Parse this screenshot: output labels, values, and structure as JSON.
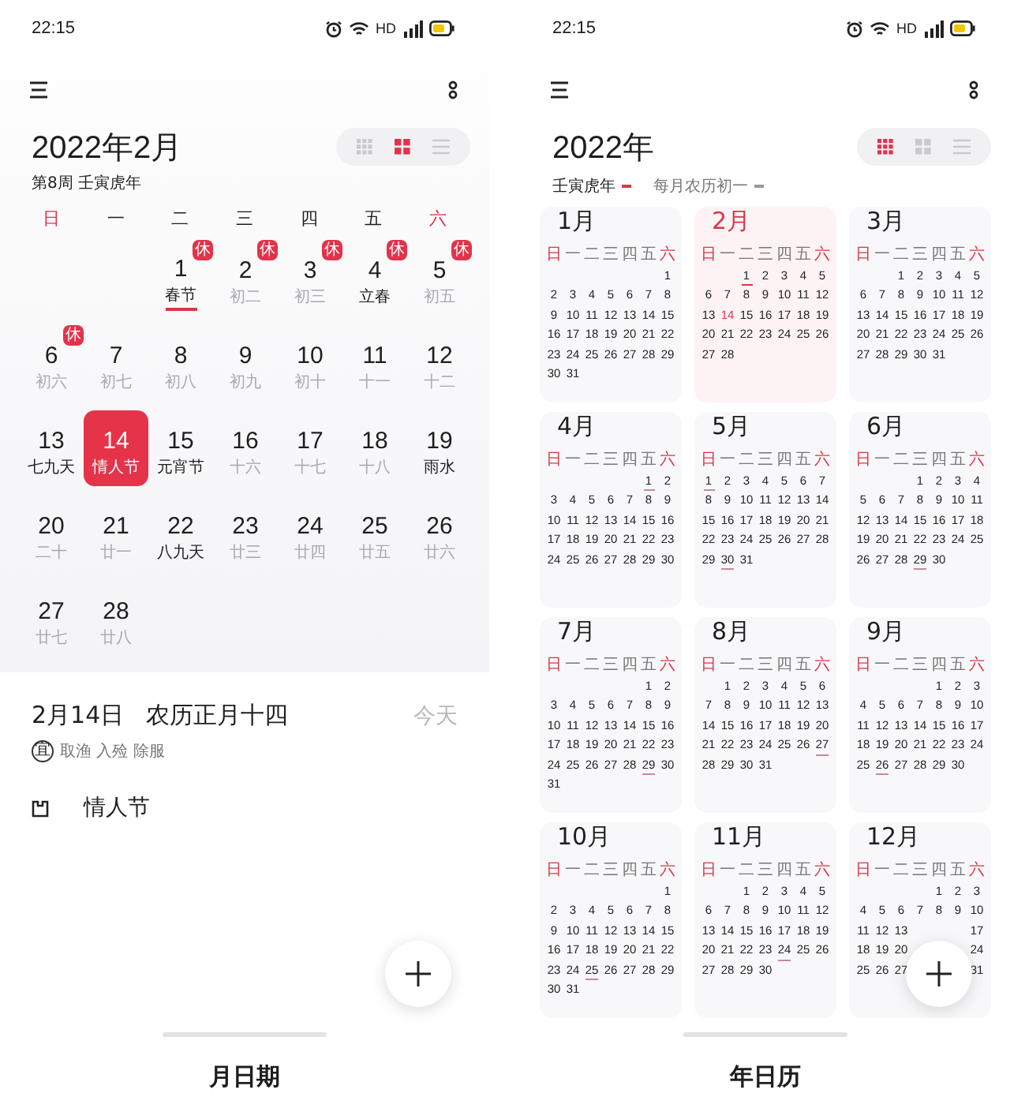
{
  "month_view": {
    "status_bar": {
      "time": "22:15",
      "network": "HD"
    },
    "title": "2022年2月",
    "subtitle": "第8周 壬寅虎年",
    "view_modes": [
      {
        "kind": "year",
        "selected": false
      },
      {
        "kind": "month",
        "selected": true
      },
      {
        "kind": "list",
        "selected": false
      }
    ],
    "weekdays": [
      {
        "label": "日",
        "weekend": true
      },
      {
        "label": "一",
        "weekend": false
      },
      {
        "label": "二",
        "weekend": false
      },
      {
        "label": "三",
        "weekend": false
      },
      {
        "label": "四",
        "weekend": false
      },
      {
        "label": "五",
        "weekend": false
      },
      {
        "label": "六",
        "weekend": true
      }
    ],
    "days": [
      {
        "day": "1",
        "label": "春节",
        "kind": "festival",
        "badge": "休",
        "selected": false,
        "underlined": true
      },
      {
        "day": "2",
        "label": "初二",
        "kind": "lunar",
        "badge": "休",
        "selected": false,
        "underlined": false
      },
      {
        "day": "3",
        "label": "初三",
        "kind": "lunar",
        "badge": "休",
        "selected": false,
        "underlined": false
      },
      {
        "day": "4",
        "label": "立春",
        "kind": "festival",
        "badge": "休",
        "selected": false,
        "underlined": false
      },
      {
        "day": "5",
        "label": "初五",
        "kind": "lunar",
        "badge": "休",
        "selected": false,
        "underlined": false
      },
      {
        "day": "6",
        "label": "初六",
        "kind": "lunar",
        "badge": "休",
        "selected": false,
        "underlined": false
      },
      {
        "day": "7",
        "label": "初七",
        "kind": "lunar",
        "selected": false,
        "underlined": false
      },
      {
        "day": "8",
        "label": "初八",
        "kind": "lunar",
        "selected": false,
        "underlined": false
      },
      {
        "day": "9",
        "label": "初九",
        "kind": "lunar",
        "selected": false,
        "underlined": false
      },
      {
        "day": "10",
        "label": "初十",
        "kind": "lunar",
        "selected": false,
        "underlined": false
      },
      {
        "day": "11",
        "label": "十一",
        "kind": "lunar",
        "selected": false,
        "underlined": false
      },
      {
        "day": "12",
        "label": "十二",
        "kind": "lunar",
        "selected": false,
        "underlined": false
      },
      {
        "day": "13",
        "label": "七九天",
        "kind": "festival",
        "selected": false,
        "underlined": false
      },
      {
        "day": "14",
        "label": "情人节",
        "kind": "festival",
        "selected": true,
        "underlined": false
      },
      {
        "day": "15",
        "label": "元宵节",
        "kind": "festival",
        "selected": false,
        "underlined": false
      },
      {
        "day": "16",
        "label": "十六",
        "kind": "lunar",
        "selected": false,
        "underlined": false
      },
      {
        "day": "17",
        "label": "十七",
        "kind": "lunar",
        "selected": false,
        "underlined": false
      },
      {
        "day": "18",
        "label": "十八",
        "kind": "lunar",
        "selected": false,
        "underlined": false
      },
      {
        "day": "19",
        "label": "雨水",
        "kind": "festival",
        "selected": false,
        "underlined": false
      },
      {
        "day": "20",
        "label": "二十",
        "kind": "lunar",
        "selected": false,
        "underlined": false
      },
      {
        "day": "21",
        "label": "廿一",
        "kind": "lunar",
        "selected": false,
        "underlined": false
      },
      {
        "day": "22",
        "label": "八九天",
        "kind": "festival",
        "selected": false,
        "underlined": false
      },
      {
        "day": "23",
        "label": "廿三",
        "kind": "lunar",
        "selected": false,
        "underlined": false
      },
      {
        "day": "24",
        "label": "廿四",
        "kind": "lunar",
        "selected": false,
        "underlined": false
      },
      {
        "day": "25",
        "label": "廿五",
        "kind": "lunar",
        "selected": false,
        "underlined": false
      },
      {
        "day": "26",
        "label": "廿六",
        "kind": "lunar",
        "selected": false,
        "underlined": false
      },
      {
        "day": "27",
        "label": "廿七",
        "kind": "lunar",
        "selected": false,
        "underlined": false
      },
      {
        "day": "28",
        "label": "廿八",
        "kind": "lunar",
        "selected": false,
        "underlined": false
      }
    ],
    "detail": {
      "date": "2月14日",
      "lunar": "农历正月十四",
      "today": "今天",
      "almanac_badge": "宜",
      "almanac": "取渔 入殓 除服",
      "events": [
        {
          "title": "情人节"
        }
      ]
    },
    "tab": "月日期"
  },
  "year_view": {
    "status_bar": {
      "time": "22:15",
      "network": "HD"
    },
    "title": "2022年",
    "legend": [
      {
        "label": "壬寅虎年",
        "kind": "holiday"
      },
      {
        "label": "每月农历初一",
        "kind": "lunar"
      }
    ],
    "view_modes": [
      {
        "kind": "year",
        "selected": true
      },
      {
        "kind": "month",
        "selected": false
      },
      {
        "kind": "list",
        "selected": false
      }
    ],
    "months": [
      {
        "title": "1月",
        "current": false,
        "weekdays": [
          "日",
          "一",
          "二",
          "三",
          "四",
          "五",
          "六"
        ],
        "days": [
          {
            "d": "1"
          },
          {
            "d": "2"
          },
          {
            "d": "3"
          },
          {
            "d": "4"
          },
          {
            "d": "5"
          },
          {
            "d": "6"
          },
          {
            "d": "7"
          },
          {
            "d": "8"
          },
          {
            "d": "9"
          },
          {
            "d": "10"
          },
          {
            "d": "11"
          },
          {
            "d": "12"
          },
          {
            "d": "13"
          },
          {
            "d": "14"
          },
          {
            "d": "15"
          },
          {
            "d": "16"
          },
          {
            "d": "17"
          },
          {
            "d": "18"
          },
          {
            "d": "19"
          },
          {
            "d": "20"
          },
          {
            "d": "21"
          },
          {
            "d": "22"
          },
          {
            "d": "23"
          },
          {
            "d": "24"
          },
          {
            "d": "25"
          },
          {
            "d": "26"
          },
          {
            "d": "27"
          },
          {
            "d": "28"
          },
          {
            "d": "29"
          },
          {
            "d": "30"
          },
          {
            "d": "31"
          }
        ]
      },
      {
        "title": "2月",
        "current": true,
        "weekdays": [
          "日",
          "一",
          "二",
          "三",
          "四",
          "五",
          "六"
        ],
        "days": [
          {
            "d": "1",
            "kind": "holiday"
          },
          {
            "d": "2"
          },
          {
            "d": "3"
          },
          {
            "d": "4"
          },
          {
            "d": "5"
          },
          {
            "d": "6"
          },
          {
            "d": "7"
          },
          {
            "d": "8"
          },
          {
            "d": "9"
          },
          {
            "d": "10"
          },
          {
            "d": "11"
          },
          {
            "d": "12"
          },
          {
            "d": "13"
          },
          {
            "d": "14",
            "kind": "today"
          },
          {
            "d": "15"
          },
          {
            "d": "16"
          },
          {
            "d": "17"
          },
          {
            "d": "18"
          },
          {
            "d": "19"
          },
          {
            "d": "20"
          },
          {
            "d": "21"
          },
          {
            "d": "22"
          },
          {
            "d": "23"
          },
          {
            "d": "24"
          },
          {
            "d": "25"
          },
          {
            "d": "26"
          },
          {
            "d": "27"
          },
          {
            "d": "28"
          }
        ]
      },
      {
        "title": "3月",
        "current": false,
        "weekdays": [
          "日",
          "一",
          "二",
          "三",
          "四",
          "五",
          "六"
        ],
        "days": [
          {
            "d": "1"
          },
          {
            "d": "2"
          },
          {
            "d": "3"
          },
          {
            "d": "4"
          },
          {
            "d": "5"
          },
          {
            "d": "6"
          },
          {
            "d": "7"
          },
          {
            "d": "8"
          },
          {
            "d": "9"
          },
          {
            "d": "10"
          },
          {
            "d": "11"
          },
          {
            "d": "12"
          },
          {
            "d": "13"
          },
          {
            "d": "14"
          },
          {
            "d": "15"
          },
          {
            "d": "16"
          },
          {
            "d": "17"
          },
          {
            "d": "18"
          },
          {
            "d": "19"
          },
          {
            "d": "20"
          },
          {
            "d": "21"
          },
          {
            "d": "22"
          },
          {
            "d": "23"
          },
          {
            "d": "24"
          },
          {
            "d": "25"
          },
          {
            "d": "26"
          },
          {
            "d": "27"
          },
          {
            "d": "28"
          },
          {
            "d": "29"
          },
          {
            "d": "30"
          },
          {
            "d": "31"
          }
        ]
      },
      {
        "title": "4月",
        "current": false,
        "weekdays": [
          "日",
          "一",
          "二",
          "三",
          "四",
          "五",
          "六"
        ],
        "days": [
          {
            "d": "1",
            "kind": "lunar"
          },
          {
            "d": "2"
          },
          {
            "d": "3"
          },
          {
            "d": "4"
          },
          {
            "d": "5"
          },
          {
            "d": "6"
          },
          {
            "d": "7"
          },
          {
            "d": "8"
          },
          {
            "d": "9"
          },
          {
            "d": "10"
          },
          {
            "d": "11"
          },
          {
            "d": "12"
          },
          {
            "d": "13"
          },
          {
            "d": "14"
          },
          {
            "d": "15"
          },
          {
            "d": "16"
          },
          {
            "d": "17"
          },
          {
            "d": "18"
          },
          {
            "d": "19"
          },
          {
            "d": "20"
          },
          {
            "d": "21"
          },
          {
            "d": "22"
          },
          {
            "d": "23"
          },
          {
            "d": "24"
          },
          {
            "d": "25"
          },
          {
            "d": "26"
          },
          {
            "d": "27"
          },
          {
            "d": "28"
          },
          {
            "d": "29"
          },
          {
            "d": "30"
          }
        ]
      },
      {
        "title": "5月",
        "current": false,
        "weekdays": [
          "日",
          "一",
          "二",
          "三",
          "四",
          "五",
          "六"
        ],
        "days": [
          {
            "d": "1",
            "kind": "lunar"
          },
          {
            "d": "2"
          },
          {
            "d": "3"
          },
          {
            "d": "4"
          },
          {
            "d": "5"
          },
          {
            "d": "6"
          },
          {
            "d": "7"
          },
          {
            "d": "8"
          },
          {
            "d": "9"
          },
          {
            "d": "10"
          },
          {
            "d": "11"
          },
          {
            "d": "12"
          },
          {
            "d": "13"
          },
          {
            "d": "14"
          },
          {
            "d": "15"
          },
          {
            "d": "16"
          },
          {
            "d": "17"
          },
          {
            "d": "18"
          },
          {
            "d": "19"
          },
          {
            "d": "20"
          },
          {
            "d": "21"
          },
          {
            "d": "22"
          },
          {
            "d": "23"
          },
          {
            "d": "24"
          },
          {
            "d": "25"
          },
          {
            "d": "26"
          },
          {
            "d": "27"
          },
          {
            "d": "28"
          },
          {
            "d": "29"
          },
          {
            "d": "30",
            "kind": "lunar"
          },
          {
            "d": "31"
          }
        ]
      },
      {
        "title": "6月",
        "current": false,
        "weekdays": [
          "日",
          "一",
          "二",
          "三",
          "四",
          "五",
          "六"
        ],
        "days": [
          {
            "d": "1"
          },
          {
            "d": "2"
          },
          {
            "d": "3"
          },
          {
            "d": "4"
          },
          {
            "d": "5"
          },
          {
            "d": "6"
          },
          {
            "d": "7"
          },
          {
            "d": "8"
          },
          {
            "d": "9"
          },
          {
            "d": "10"
          },
          {
            "d": "11"
          },
          {
            "d": "12"
          },
          {
            "d": "13"
          },
          {
            "d": "14"
          },
          {
            "d": "15"
          },
          {
            "d": "16"
          },
          {
            "d": "17"
          },
          {
            "d": "18"
          },
          {
            "d": "19"
          },
          {
            "d": "20"
          },
          {
            "d": "21"
          },
          {
            "d": "22"
          },
          {
            "d": "23"
          },
          {
            "d": "24"
          },
          {
            "d": "25"
          },
          {
            "d": "26"
          },
          {
            "d": "27"
          },
          {
            "d": "28"
          },
          {
            "d": "29",
            "kind": "lunar"
          },
          {
            "d": "30"
          }
        ]
      },
      {
        "title": "7月",
        "current": false,
        "weekdays": [
          "日",
          "一",
          "二",
          "三",
          "四",
          "五",
          "六"
        ],
        "days": [
          {
            "d": "1"
          },
          {
            "d": "2"
          },
          {
            "d": "3"
          },
          {
            "d": "4"
          },
          {
            "d": "5"
          },
          {
            "d": "6"
          },
          {
            "d": "7"
          },
          {
            "d": "8"
          },
          {
            "d": "9"
          },
          {
            "d": "10"
          },
          {
            "d": "11"
          },
          {
            "d": "12"
          },
          {
            "d": "13"
          },
          {
            "d": "14"
          },
          {
            "d": "15"
          },
          {
            "d": "16"
          },
          {
            "d": "17"
          },
          {
            "d": "18"
          },
          {
            "d": "19"
          },
          {
            "d": "20"
          },
          {
            "d": "21"
          },
          {
            "d": "22"
          },
          {
            "d": "23"
          },
          {
            "d": "24"
          },
          {
            "d": "25"
          },
          {
            "d": "26"
          },
          {
            "d": "27"
          },
          {
            "d": "28"
          },
          {
            "d": "29",
            "kind": "lunar"
          },
          {
            "d": "30"
          },
          {
            "d": "31"
          }
        ]
      },
      {
        "title": "8月",
        "current": false,
        "weekdays": [
          "日",
          "一",
          "二",
          "三",
          "四",
          "五",
          "六"
        ],
        "days": [
          {
            "d": "1"
          },
          {
            "d": "2"
          },
          {
            "d": "3"
          },
          {
            "d": "4"
          },
          {
            "d": "5"
          },
          {
            "d": "6"
          },
          {
            "d": "7"
          },
          {
            "d": "8"
          },
          {
            "d": "9"
          },
          {
            "d": "10"
          },
          {
            "d": "11"
          },
          {
            "d": "12"
          },
          {
            "d": "13"
          },
          {
            "d": "14"
          },
          {
            "d": "15"
          },
          {
            "d": "16"
          },
          {
            "d": "17"
          },
          {
            "d": "18"
          },
          {
            "d": "19"
          },
          {
            "d": "20"
          },
          {
            "d": "21"
          },
          {
            "d": "22"
          },
          {
            "d": "23"
          },
          {
            "d": "24"
          },
          {
            "d": "25"
          },
          {
            "d": "26"
          },
          {
            "d": "27",
            "kind": "lunar"
          },
          {
            "d": "28"
          },
          {
            "d": "29"
          },
          {
            "d": "30"
          },
          {
            "d": "31"
          }
        ]
      },
      {
        "title": "9月",
        "current": false,
        "weekdays": [
          "日",
          "一",
          "二",
          "三",
          "四",
          "五",
          "六"
        ],
        "days": [
          {
            "d": "1"
          },
          {
            "d": "2"
          },
          {
            "d": "3"
          },
          {
            "d": "4"
          },
          {
            "d": "5"
          },
          {
            "d": "6"
          },
          {
            "d": "7"
          },
          {
            "d": "8"
          },
          {
            "d": "9"
          },
          {
            "d": "10"
          },
          {
            "d": "11"
          },
          {
            "d": "12"
          },
          {
            "d": "13"
          },
          {
            "d": "14"
          },
          {
            "d": "15"
          },
          {
            "d": "16"
          },
          {
            "d": "17"
          },
          {
            "d": "18"
          },
          {
            "d": "19"
          },
          {
            "d": "20"
          },
          {
            "d": "21"
          },
          {
            "d": "22"
          },
          {
            "d": "23"
          },
          {
            "d": "24"
          },
          {
            "d": "25"
          },
          {
            "d": "26",
            "kind": "lunar"
          },
          {
            "d": "27"
          },
          {
            "d": "28"
          },
          {
            "d": "29"
          },
          {
            "d": "30"
          }
        ]
      },
      {
        "title": "10月",
        "current": false,
        "weekdays": [
          "日",
          "一",
          "二",
          "三",
          "四",
          "五",
          "六"
        ],
        "days": [
          {
            "d": "1"
          },
          {
            "d": "2"
          },
          {
            "d": "3"
          },
          {
            "d": "4"
          },
          {
            "d": "5"
          },
          {
            "d": "6"
          },
          {
            "d": "7"
          },
          {
            "d": "8"
          },
          {
            "d": "9"
          },
          {
            "d": "10"
          },
          {
            "d": "11"
          },
          {
            "d": "12"
          },
          {
            "d": "13"
          },
          {
            "d": "14"
          },
          {
            "d": "15"
          },
          {
            "d": "16"
          },
          {
            "d": "17"
          },
          {
            "d": "18"
          },
          {
            "d": "19"
          },
          {
            "d": "20"
          },
          {
            "d": "21"
          },
          {
            "d": "22"
          },
          {
            "d": "23"
          },
          {
            "d": "24"
          },
          {
            "d": "25",
            "kind": "lunar"
          },
          {
            "d": "26"
          },
          {
            "d": "27"
          },
          {
            "d": "28"
          },
          {
            "d": "29"
          },
          {
            "d": "30"
          },
          {
            "d": "31"
          }
        ]
      },
      {
        "title": "11月",
        "current": false,
        "weekdays": [
          "日",
          "一",
          "二",
          "三",
          "四",
          "五",
          "六"
        ],
        "days": [
          {
            "d": "1"
          },
          {
            "d": "2"
          },
          {
            "d": "3"
          },
          {
            "d": "4"
          },
          {
            "d": "5"
          },
          {
            "d": "6"
          },
          {
            "d": "7"
          },
          {
            "d": "8"
          },
          {
            "d": "9"
          },
          {
            "d": "10"
          },
          {
            "d": "11"
          },
          {
            "d": "12"
          },
          {
            "d": "13"
          },
          {
            "d": "14"
          },
          {
            "d": "15"
          },
          {
            "d": "16"
          },
          {
            "d": "17"
          },
          {
            "d": "18"
          },
          {
            "d": "19"
          },
          {
            "d": "20"
          },
          {
            "d": "21"
          },
          {
            "d": "22"
          },
          {
            "d": "23"
          },
          {
            "d": "24",
            "kind": "lunar"
          },
          {
            "d": "25"
          },
          {
            "d": "26"
          },
          {
            "d": "27"
          },
          {
            "d": "28"
          },
          {
            "d": "29"
          },
          {
            "d": "30"
          }
        ]
      },
      {
        "title": "12月",
        "current": false,
        "weekdays": [
          "日",
          "一",
          "二",
          "三",
          "四",
          "五",
          "六"
        ],
        "days": [
          {
            "d": "1"
          },
          {
            "d": "2"
          },
          {
            "d": "3"
          },
          {
            "d": "4"
          },
          {
            "d": "5"
          },
          {
            "d": "6"
          },
          {
            "d": "7"
          },
          {
            "d": "8"
          },
          {
            "d": "9"
          },
          {
            "d": "10"
          },
          {
            "d": "11"
          },
          {
            "d": "12"
          },
          {
            "d": "13"
          },
          {
            "kind": "covered"
          },
          {
            "kind": "covered"
          },
          {
            "kind": "covered"
          },
          {
            "d": "17"
          },
          {
            "d": "18"
          },
          {
            "d": "19"
          },
          {
            "d": "20"
          },
          {
            "kind": "covered"
          },
          {
            "kind": "covered"
          },
          {
            "kind": "covered"
          },
          {
            "d": "24"
          },
          {
            "d": "25"
          },
          {
            "d": "26"
          },
          {
            "d": "27"
          },
          {
            "kind": "covered"
          },
          {
            "kind": "covered"
          },
          {
            "kind": "covered"
          },
          {
            "d": "31"
          }
        ]
      }
    ],
    "tab": "年日历"
  }
}
